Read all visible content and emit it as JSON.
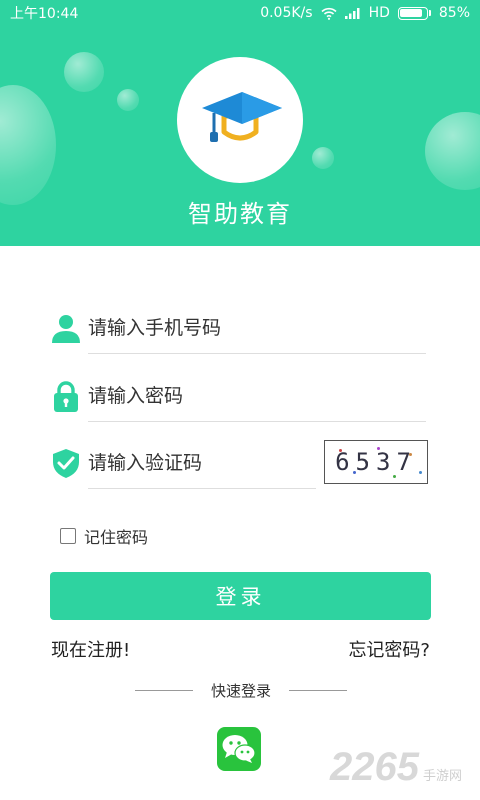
{
  "status_bar": {
    "time": "上午10:44",
    "network_speed": "0.05K/s",
    "network_type": "HD",
    "battery_percent": "85%",
    "battery_level": 0.85
  },
  "header": {
    "app_title": "智助教育",
    "logo_icon": "graduation-cap-icon",
    "background_color": "#2ed3a0"
  },
  "form": {
    "phone": {
      "placeholder": "请输入手机号码",
      "value": "",
      "icon": "user-icon"
    },
    "password": {
      "placeholder": "请输入密码",
      "value": "",
      "icon": "lock-icon"
    },
    "captcha": {
      "placeholder": "请输入验证码",
      "value": "",
      "icon": "shield-check-icon",
      "image_text": "6537"
    },
    "remember_label": "记住密码",
    "remember_checked": false,
    "login_label": "登录"
  },
  "links": {
    "register": "现在注册!",
    "forgot": "忘记密码?"
  },
  "quick_login": {
    "label": "快速登录",
    "icon": "wechat-icon"
  },
  "watermark": {
    "number": "2265",
    "text": "手游网"
  },
  "colors": {
    "accent": "#2ed3a0",
    "wechat": "#29c33d"
  }
}
